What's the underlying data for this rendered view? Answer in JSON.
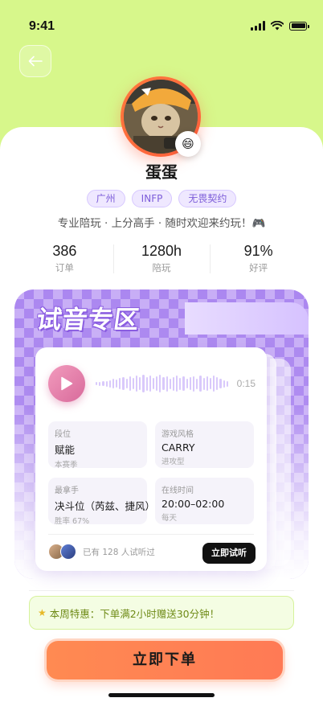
{
  "status_bar": {
    "time": "9:41"
  },
  "profile": {
    "nickname": "蛋蛋",
    "tags": [
      "广州",
      "INFP",
      "无畏契约"
    ],
    "bio": "专业陪玩 · 上分高手 · 随时欢迎来约玩！🎮",
    "emoji_badge": "😄"
  },
  "stats": [
    {
      "value": "386",
      "label": "订单"
    },
    {
      "value": "1280h",
      "label": "陪玩"
    },
    {
      "value": "91%",
      "label": "好评"
    }
  ],
  "trial_zone": {
    "title": "试音专区",
    "audio_duration": "0:15",
    "info": [
      {
        "label": "段位",
        "value": "赋能",
        "sub": "本赛季"
      },
      {
        "label": "游戏风格",
        "value": "CARRY",
        "sub": "进攻型"
      },
      {
        "label": "最拿手",
        "value": "决斗位（芮兹、捷风）",
        "sub": "胜率 67%"
      },
      {
        "label": "在线时间",
        "value": "20:00–02:00",
        "sub": "每天"
      }
    ],
    "listeners_text": "已有 128 人试听过",
    "try_button": "立即试听"
  },
  "promo": {
    "icon": "star-icon",
    "text": "本周特惠：下单满2小时赠送30分钟！"
  },
  "order_button": "立即下单",
  "colors": {
    "background": "#d7f78b",
    "accent_purple": "#ab87f0",
    "order_orange": "#ff7a55",
    "play_pink": "#d86a9b"
  }
}
